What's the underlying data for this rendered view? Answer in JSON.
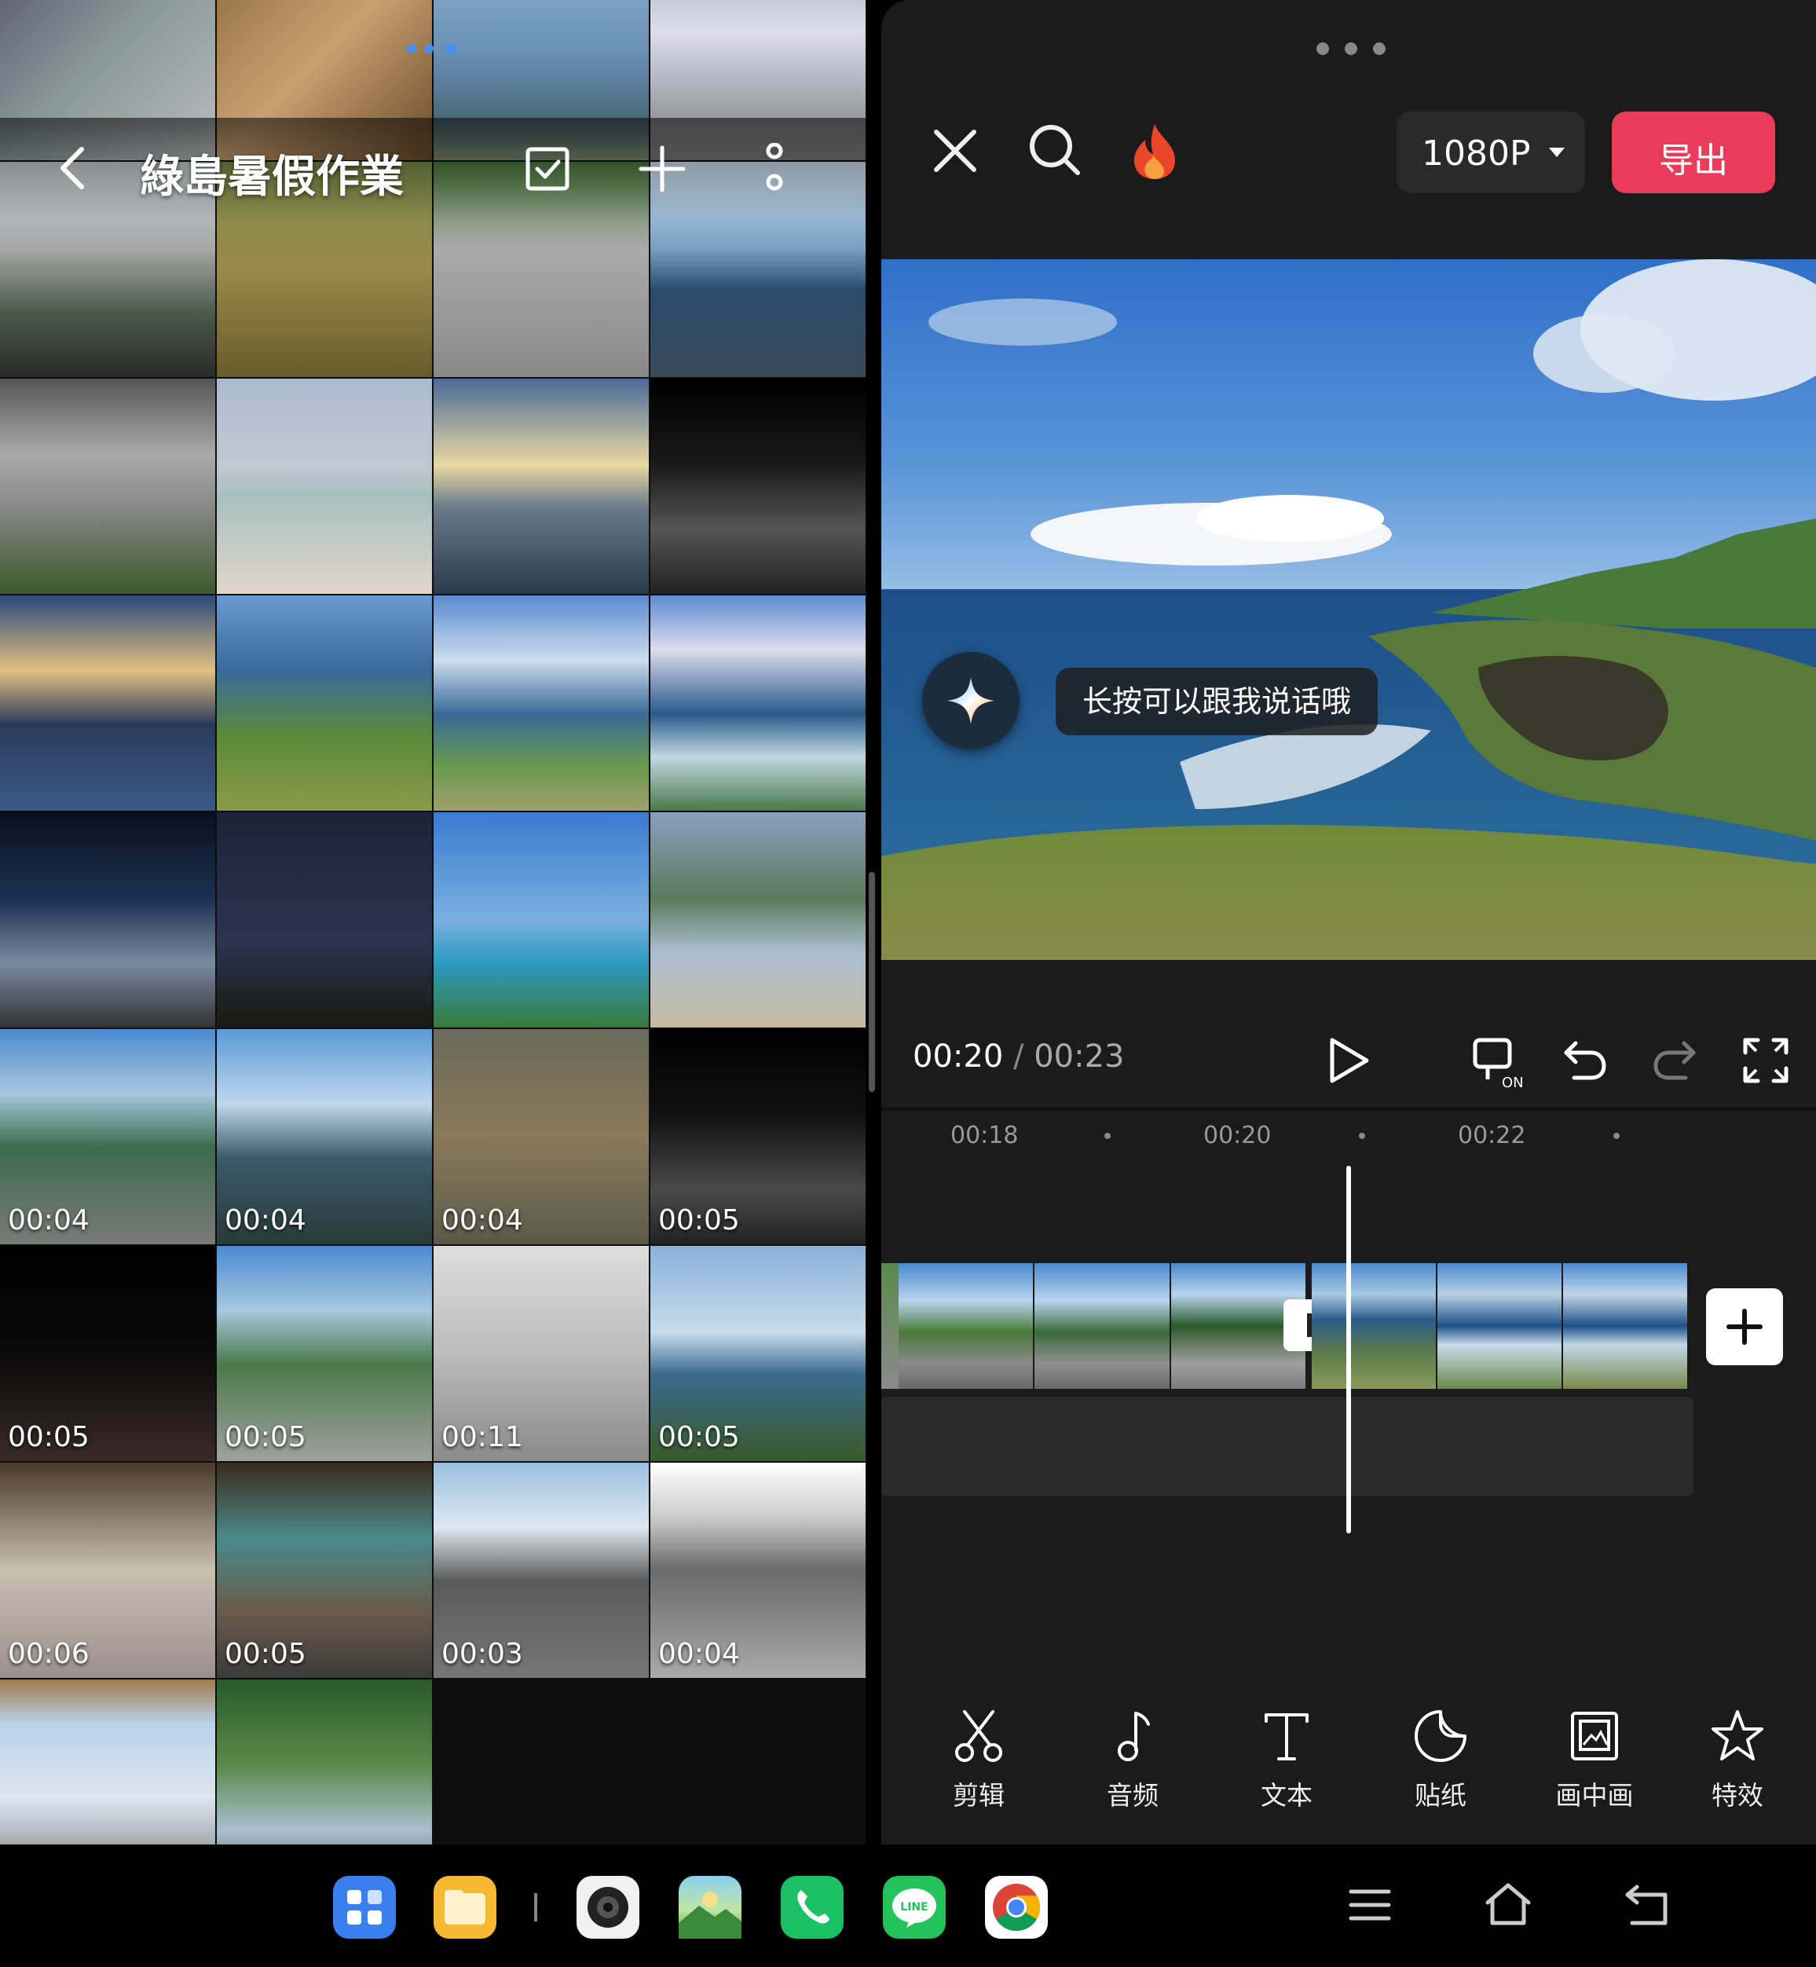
{
  "gallery": {
    "album_title": "綠島暑假作業",
    "durations": [
      "00:04",
      "00:04",
      "00:04",
      "00:05",
      "00:05",
      "00:05",
      "00:11",
      "00:05",
      "00:06",
      "00:05",
      "00:03",
      "00:04"
    ]
  },
  "editor": {
    "resolution": "1080P",
    "export_label": "导出",
    "ai_hint": "长按可以跟我说话哦",
    "current_time": "00:20",
    "separator": "/",
    "total_time": "00:23",
    "ruler_ticks": [
      "00:18",
      "00:20",
      "00:22"
    ],
    "tools": [
      {
        "label": "剪辑",
        "icon": "scissors-icon"
      },
      {
        "label": "音频",
        "icon": "music-note-icon"
      },
      {
        "label": "文本",
        "icon": "text-icon"
      },
      {
        "label": "贴纸",
        "icon": "sticker-icon"
      },
      {
        "label": "画中画",
        "icon": "picture-in-picture-icon"
      },
      {
        "label": "特效",
        "icon": "effects-star-icon"
      }
    ]
  },
  "dock": {
    "apps": [
      "app-drawer-icon",
      "files-icon",
      "camera-icon",
      "gallery-icon",
      "phone-icon",
      "line-icon",
      "chrome-icon"
    ],
    "line_label": "LINE"
  },
  "colors": {
    "accent": "#ea3b5b",
    "panel": "#1b1b1b",
    "chip": "#2a2a2a"
  }
}
